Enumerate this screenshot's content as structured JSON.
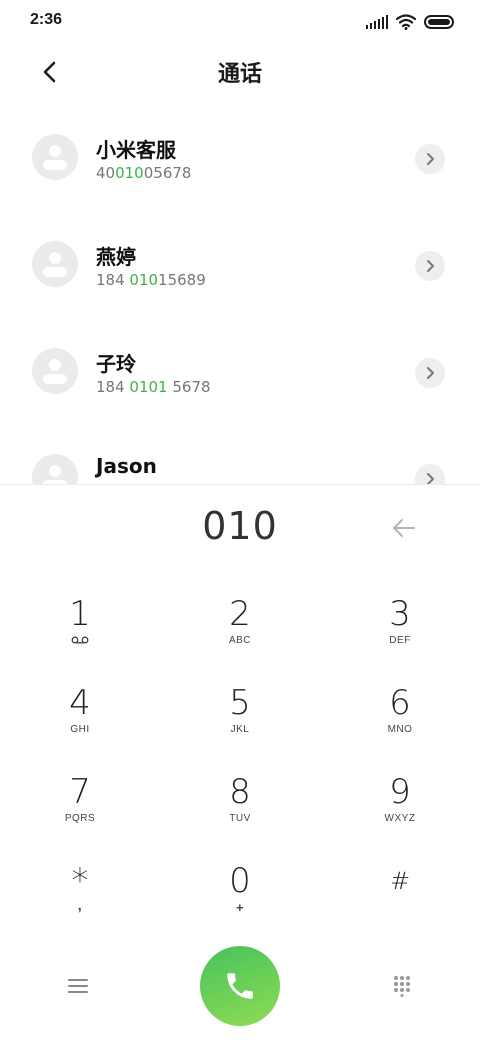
{
  "status_bar": {
    "time": "2:36",
    "icons": [
      "signal-icon",
      "wifi-icon",
      "battery-icon"
    ]
  },
  "header": {
    "title": "通话",
    "back_icon": "chevron-left-icon"
  },
  "contacts": [
    {
      "name": "小米客服",
      "number_parts": [
        "40",
        "010",
        "05678"
      ]
    },
    {
      "name": "燕婷",
      "number_parts": [
        "184 ",
        "010",
        "15689"
      ]
    },
    {
      "name": "子玲",
      "number_parts": [
        "184 ",
        "0101",
        " 5678"
      ]
    },
    {
      "name": "Jason",
      "number_parts": [
        "",
        "",
        ""
      ]
    }
  ],
  "dialer": {
    "input": "010",
    "backspace_icon": "backspace-arrow-icon"
  },
  "keypad": [
    {
      "digit": "1",
      "letters": "",
      "sub_icon": "voicemail-icon"
    },
    {
      "digit": "2",
      "letters": "ABC"
    },
    {
      "digit": "3",
      "letters": "DEF"
    },
    {
      "digit": "4",
      "letters": "GHI"
    },
    {
      "digit": "5",
      "letters": "JKL"
    },
    {
      "digit": "6",
      "letters": "MNO"
    },
    {
      "digit": "7",
      "letters": "PQRS"
    },
    {
      "digit": "8",
      "letters": "TUV"
    },
    {
      "digit": "9",
      "letters": "WXYZ"
    },
    {
      "digit": "*",
      "letters": ","
    },
    {
      "digit": "0",
      "letters": "+"
    },
    {
      "digit": "#",
      "letters": ""
    }
  ],
  "bottom_bar": {
    "menu_icon": "menu-icon",
    "call_icon": "phone-icon",
    "keypad_icon": "dialpad-icon"
  },
  "colors": {
    "highlight": "#3bb34a",
    "call_gradient_start": "#47c25d",
    "call_gradient_end": "#8fdc52"
  }
}
